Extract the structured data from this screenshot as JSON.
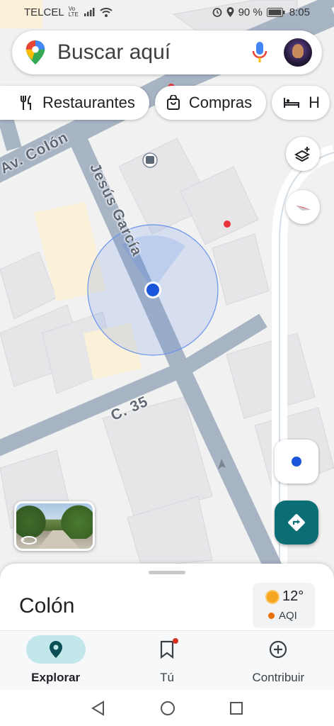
{
  "status_bar": {
    "carrier": "TELCEL",
    "network_badge": "Vo LTE",
    "battery_percent": "90 %",
    "time": "8:05",
    "icons": [
      "signal-icon",
      "wifi-icon",
      "alarm-icon",
      "location-icon",
      "battery-icon"
    ]
  },
  "search": {
    "placeholder": "Buscar aquí",
    "icons": [
      "maps-pin-icon",
      "microphone-icon",
      "avatar"
    ]
  },
  "chips": [
    {
      "label": "Restaurantes",
      "icon": "restaurant-icon"
    },
    {
      "label": "Compras",
      "icon": "shopping-bag-icon"
    },
    {
      "label": "H",
      "icon": "hotel-icon"
    }
  ],
  "map": {
    "streets": [
      "Av. Colón",
      "Jesús García",
      "C. 35"
    ],
    "layers_icon": "layers-icon",
    "compass_icon": "compass-icon",
    "my_location_icon": "my-location-icon",
    "directions_icon": "directions-icon",
    "street_view_icon": "street-view-rotate-icon"
  },
  "sheet": {
    "place_name": "Colón",
    "weather": {
      "temperature": "12°",
      "aqi_label": "AQI"
    }
  },
  "bottom_nav": [
    {
      "label": "Explorar",
      "icon": "explore-pin-icon",
      "active": true
    },
    {
      "label": "Tú",
      "icon": "bookmark-icon",
      "active": false
    },
    {
      "label": "Contribuir",
      "icon": "add-circle-icon",
      "active": false
    }
  ],
  "system_nav": [
    "back-icon",
    "home-icon",
    "recents-icon"
  ],
  "colors": {
    "accent_teal": "#0b6e74",
    "location_blue": "#1a56db",
    "nav_active_bg": "#c2e7ea",
    "road_fill": "#a7b4c4"
  }
}
